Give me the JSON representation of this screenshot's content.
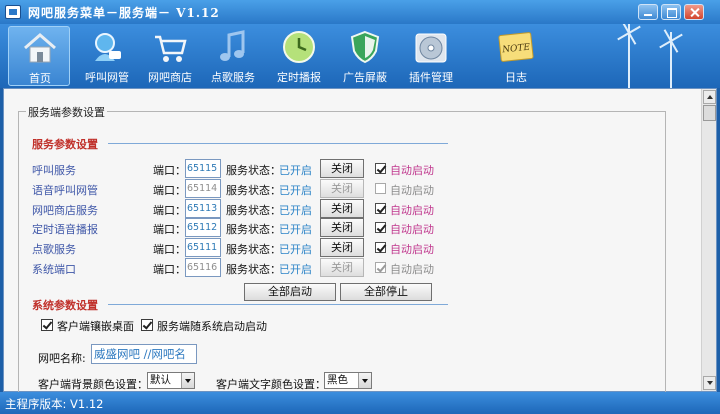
{
  "window": {
    "title": "网吧服务菜单－服务端－ V1.12"
  },
  "toolbar": {
    "items": [
      {
        "label": "首页",
        "icon": "home-icon"
      },
      {
        "label": "呼叫网管",
        "icon": "call-admin-icon"
      },
      {
        "label": "网吧商店",
        "icon": "shopping-cart-icon"
      },
      {
        "label": "点歌服务",
        "icon": "music-note-icon"
      },
      {
        "label": "定时播报",
        "icon": "clock-icon"
      },
      {
        "label": "广告屏蔽",
        "icon": "shield-icon"
      },
      {
        "label": "插件管理",
        "icon": "plugin-disc-icon"
      },
      {
        "label": "日志",
        "icon": "note-icon",
        "badge": "NOTE"
      }
    ]
  },
  "main": {
    "group_title": "服务端参数设置",
    "service_section_title": "服务参数设置",
    "port_label": "端口：",
    "status_label": "服务状态：",
    "services": [
      {
        "name": "呼叫服务",
        "port": "65115",
        "status": "已开启",
        "button": "关闭",
        "auto_start": "自动启动",
        "enabled": true,
        "auto_checked": true
      },
      {
        "name": "语音呼叫网管",
        "port": "65114",
        "status": "已开启",
        "button": "关闭",
        "auto_start": "自动启动",
        "enabled": false,
        "auto_checked": false
      },
      {
        "name": "网吧商店服务",
        "port": "65113",
        "status": "已开启",
        "button": "关闭",
        "auto_start": "自动启动",
        "enabled": true,
        "auto_checked": true
      },
      {
        "name": "定时语音播报",
        "port": "65112",
        "status": "已开启",
        "button": "关闭",
        "auto_start": "自动启动",
        "enabled": true,
        "auto_checked": true
      },
      {
        "name": "点歌服务",
        "port": "65111",
        "status": "已开启",
        "button": "关闭",
        "auto_start": "自动启动",
        "enabled": true,
        "auto_checked": true
      },
      {
        "name": "系统端口",
        "port": "65116",
        "status": "已开启",
        "button": "关闭",
        "auto_start": "自动启动",
        "enabled": false,
        "auto_checked": true
      }
    ],
    "start_all": "全部启动",
    "stop_all": "全部停止",
    "system_section_title": "系统参数设置",
    "client_embed": "客户端镶嵌桌面",
    "server_autostart": "服务端随系统启动启动",
    "cafe_name_label": "网吧名称:",
    "cafe_name_value": "威盛网吧   //网吧名",
    "client_bg_label": "客户端背景颜色设置：",
    "client_bg_value": "默认",
    "client_text_label": "客户端文字颜色设置：",
    "client_text_value": "黑色"
  },
  "statusbar": {
    "version_text": "主程序版本: V1.12"
  }
}
